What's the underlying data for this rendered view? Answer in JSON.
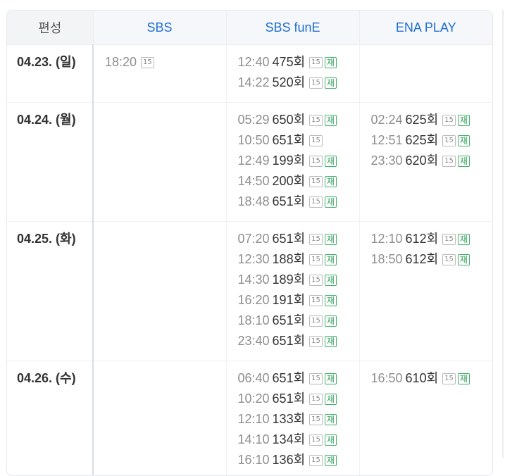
{
  "header": {
    "date_col": "편성",
    "channels": [
      "SBS",
      "SBS funE",
      "ENA PLAY"
    ]
  },
  "badges": {
    "rating": "15",
    "rerun": "재"
  },
  "colors": {
    "channel_header": "#1f6fd1",
    "rerun_badge": "#2e9f58",
    "time_text": "#8e8e8e"
  },
  "days": [
    {
      "date": "04.23. (일)",
      "sbs": [
        {
          "time": "18:20",
          "episode": "",
          "rerun": false
        }
      ],
      "fune": [
        {
          "time": "12:40",
          "episode": "475회",
          "rerun": true
        },
        {
          "time": "14:22",
          "episode": "520회",
          "rerun": true
        }
      ],
      "ena": []
    },
    {
      "date": "04.24. (월)",
      "sbs": [],
      "fune": [
        {
          "time": "05:29",
          "episode": "650회",
          "rerun": true
        },
        {
          "time": "10:50",
          "episode": "651회",
          "rerun": false
        },
        {
          "time": "12:49",
          "episode": "199회",
          "rerun": true
        },
        {
          "time": "14:50",
          "episode": "200회",
          "rerun": true
        },
        {
          "time": "18:48",
          "episode": "651회",
          "rerun": true
        }
      ],
      "ena": [
        {
          "time": "02:24",
          "episode": "625회",
          "rerun": true
        },
        {
          "time": "12:51",
          "episode": "625회",
          "rerun": true
        },
        {
          "time": "23:30",
          "episode": "620회",
          "rerun": true
        }
      ]
    },
    {
      "date": "04.25. (화)",
      "sbs": [],
      "fune": [
        {
          "time": "07:20",
          "episode": "651회",
          "rerun": true
        },
        {
          "time": "12:30",
          "episode": "188회",
          "rerun": true
        },
        {
          "time": "14:30",
          "episode": "189회",
          "rerun": true
        },
        {
          "time": "16:20",
          "episode": "191회",
          "rerun": true
        },
        {
          "time": "18:10",
          "episode": "651회",
          "rerun": true
        },
        {
          "time": "23:40",
          "episode": "651회",
          "rerun": true
        }
      ],
      "ena": [
        {
          "time": "12:10",
          "episode": "612회",
          "rerun": true
        },
        {
          "time": "18:50",
          "episode": "612회",
          "rerun": true
        }
      ]
    },
    {
      "date": "04.26. (수)",
      "sbs": [],
      "fune": [
        {
          "time": "06:40",
          "episode": "651회",
          "rerun": true
        },
        {
          "time": "10:20",
          "episode": "651회",
          "rerun": true
        },
        {
          "time": "12:10",
          "episode": "133회",
          "rerun": true
        },
        {
          "time": "14:10",
          "episode": "134회",
          "rerun": true
        },
        {
          "time": "16:10",
          "episode": "136회",
          "rerun": true
        }
      ],
      "ena": [
        {
          "time": "16:50",
          "episode": "610회",
          "rerun": true
        }
      ]
    }
  ]
}
